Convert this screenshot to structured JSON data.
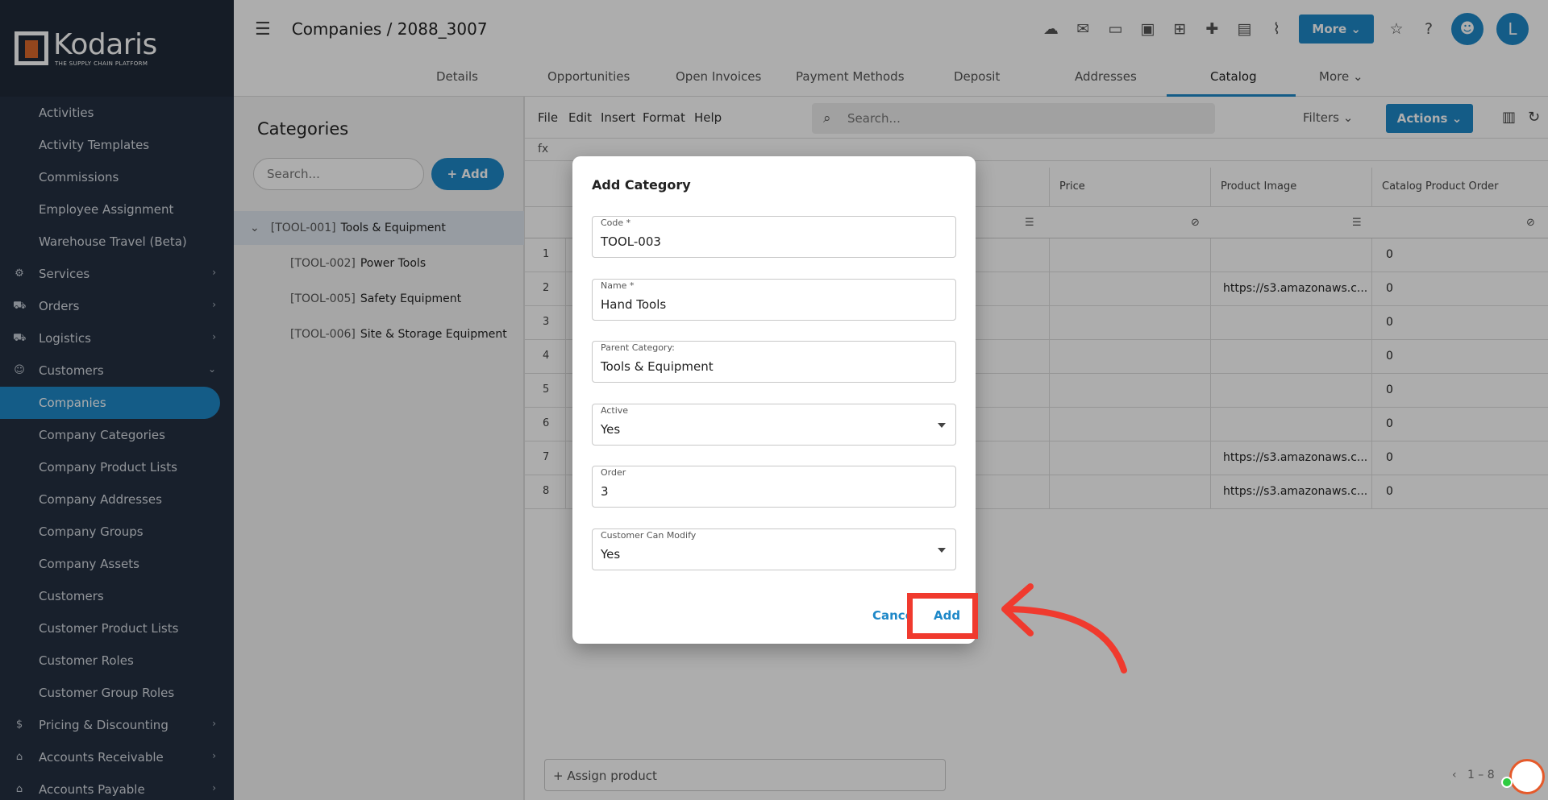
{
  "brand": {
    "name": "Kodaris",
    "tagline": "THE SUPPLY CHAIN PLATFORM"
  },
  "sidebar": {
    "items": [
      {
        "label": "Activities",
        "type": "sub"
      },
      {
        "label": "Activity Templates",
        "type": "sub"
      },
      {
        "label": "Commissions",
        "type": "sub"
      },
      {
        "label": "Employee Assignment",
        "type": "sub"
      },
      {
        "label": "Warehouse Travel (Beta)",
        "type": "sub"
      },
      {
        "label": "Services",
        "type": "section",
        "icon": "services-icon"
      },
      {
        "label": "Orders",
        "type": "section",
        "icon": "truck-icon"
      },
      {
        "label": "Logistics",
        "type": "section",
        "icon": "logistics-icon"
      },
      {
        "label": "Customers",
        "type": "section",
        "icon": "people-icon",
        "expanded": true
      },
      {
        "label": "Companies",
        "type": "sub",
        "active": true
      },
      {
        "label": "Company Categories",
        "type": "sub"
      },
      {
        "label": "Company Product Lists",
        "type": "sub"
      },
      {
        "label": "Company Addresses",
        "type": "sub"
      },
      {
        "label": "Company Groups",
        "type": "sub"
      },
      {
        "label": "Company Assets",
        "type": "sub"
      },
      {
        "label": "Customers",
        "type": "sub"
      },
      {
        "label": "Customer Product Lists",
        "type": "sub"
      },
      {
        "label": "Customer Roles",
        "type": "sub"
      },
      {
        "label": "Customer Group Roles",
        "type": "sub"
      },
      {
        "label": "Pricing & Discounting",
        "type": "section",
        "icon": "dollar-icon"
      },
      {
        "label": "Accounts Receivable",
        "type": "section",
        "icon": "bank-icon"
      },
      {
        "label": "Accounts Payable",
        "type": "section",
        "icon": "bank-icon"
      }
    ]
  },
  "header": {
    "title": "Companies / 2088_3007",
    "more_label": "More",
    "avatar_initial": "L"
  },
  "tabs": {
    "items": [
      "Details",
      "Opportunities",
      "Open Invoices",
      "Payment Methods",
      "Deposit",
      "Addresses",
      "Catalog",
      "More"
    ],
    "active": "Catalog"
  },
  "categories": {
    "title": "Categories",
    "search_placeholder": "Search...",
    "add_label": "Add",
    "tree": [
      {
        "code": "[TOOL-001]",
        "name": "Tools & Equipment",
        "selected": true
      },
      {
        "code": "[TOOL-002]",
        "name": "Power Tools"
      },
      {
        "code": "[TOOL-005]",
        "name": "Safety Equipment"
      },
      {
        "code": "[TOOL-006]",
        "name": "Site & Storage Equipment"
      }
    ]
  },
  "grid": {
    "menu": [
      "File",
      "Edit",
      "Insert",
      "Format",
      "Help"
    ],
    "search_placeholder": "Search...",
    "filters_label": "Filters",
    "actions_label": "Actions",
    "fx_label": "fx",
    "columns": [
      "Price",
      "Product Image",
      "Catalog Product Order"
    ],
    "rows": [
      {
        "num": "1",
        "image": "",
        "order": "0"
      },
      {
        "num": "2",
        "image": "https://s3.amazonaws.c...",
        "order": "0"
      },
      {
        "num": "3",
        "image": "",
        "order": "0"
      },
      {
        "num": "4",
        "image": "",
        "order": "0"
      },
      {
        "num": "5",
        "image": "",
        "order": "0"
      },
      {
        "num": "6",
        "image": "",
        "order": "0"
      },
      {
        "num": "7",
        "image": "https://s3.amazonaws.c...",
        "order": "0"
      },
      {
        "num": "8",
        "image": "https://s3.amazonaws.c...",
        "order": "0"
      }
    ],
    "assign_label": "+ Assign product",
    "pager_text": "1 – 8"
  },
  "dialog": {
    "title": "Add Category",
    "fields": [
      {
        "label": "Code *",
        "value": "TOOL-003",
        "select": false
      },
      {
        "label": "Name *",
        "value": "Hand Tools",
        "select": false
      },
      {
        "label": "Parent Category:",
        "value": "Tools & Equipment",
        "select": false
      },
      {
        "label": "Active",
        "value": "Yes",
        "select": true
      },
      {
        "label": "Order",
        "value": "3",
        "select": false
      },
      {
        "label": "Customer Can Modify",
        "value": "Yes",
        "select": true
      }
    ],
    "cancel_label": "Cancel",
    "add_label": "Add"
  },
  "colors": {
    "accent": "#1e88c8",
    "sidebar_bg": "#243041",
    "highlight": "#f03a2e"
  }
}
